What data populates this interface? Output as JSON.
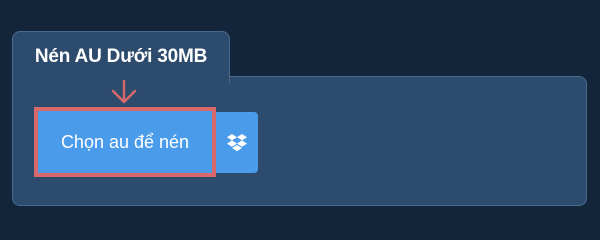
{
  "tab": {
    "title": "Nén AU Dưới 30MB"
  },
  "upload": {
    "choose_label": "Chọn au để nén",
    "dropbox_icon": "dropbox-icon"
  },
  "annotation": {
    "arrow_icon": "arrow-down-icon",
    "highlight_color": "#d9686b"
  },
  "colors": {
    "background": "#13253a",
    "panel": "#2c4b6d",
    "button": "#4a9bea"
  }
}
